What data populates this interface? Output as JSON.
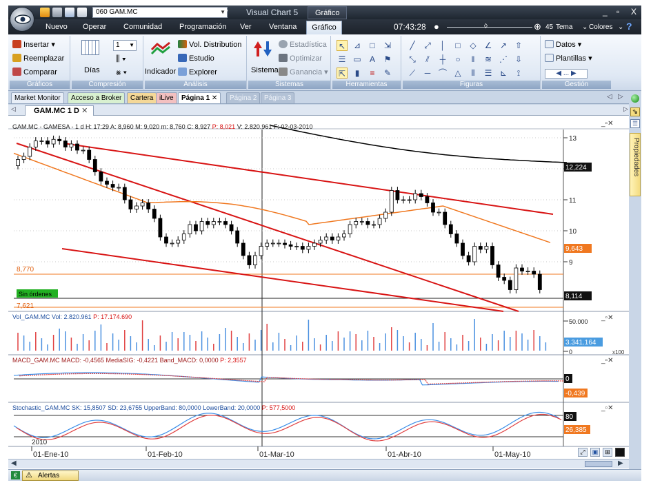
{
  "titlebar": {
    "symbol_value": "060 GAM.MC",
    "app_title": "Visual Chart 5",
    "context_tab": "Gráfico",
    "min_label": "_",
    "max_label": "▫",
    "close_label": "X"
  },
  "menubar": {
    "items": [
      "Nuevo",
      "Operar",
      "Comunidad",
      "Programación",
      "Ver",
      "Ventana",
      "Gráfico"
    ],
    "clock": "07:43:28",
    "zoom": "45",
    "tema": "Tema",
    "colores": "Colores"
  },
  "ribbon": {
    "graficos": {
      "label": "Gráficos",
      "insertar": "Insertar",
      "reemplazar": "Reemplazar",
      "comparar": "Comparar"
    },
    "compresion": {
      "label": "Compresión",
      "dias": "Días",
      "value": "1"
    },
    "analisis": {
      "label": "Análisis",
      "indicador": "Indicador",
      "vol": "Vol. Distribution",
      "estudio": "Estudio",
      "explorer": "Explorer"
    },
    "sistemas": {
      "label": "Sistemas",
      "sistema": "Sistema",
      "estadistica": "Estadística",
      "optimizar": "Optimizar",
      "ganancia": "Ganancia"
    },
    "herramientas": {
      "label": "Herramientas"
    },
    "figuras": {
      "label": "Figuras"
    },
    "gestion": {
      "label": "Gestión",
      "datos": "Datos",
      "plantillas": "Plantillas",
      "nav": "..."
    }
  },
  "pagetabs": [
    "Market Monitor",
    "Acceso a Broker",
    "Cartera",
    "iLive",
    "Página 1",
    "Página 2",
    "Página 3"
  ],
  "doc_tab": "GAM.MC 1 D",
  "side_tab": "Propiedades",
  "price_panel": {
    "header": "GAM.MC - GAMESA - 1 d H: 17:29 A: 8,960 M: 9,020 m: 8,760 C: 8,927",
    "header_p": "P: 8,021",
    "header_tail": "V: 2.820.961 F: 02-03-2010",
    "ticks": [
      "13",
      "12",
      "11",
      "10",
      "9"
    ],
    "line_labels": [
      "8,770",
      "7,621"
    ],
    "sin_ordenes": "Sin órdenes",
    "last_marks": [
      "12,224",
      "9,643",
      "8,114"
    ],
    "colors": {
      "black": "#000000",
      "orange": "#f07820",
      "red": "#d81414"
    }
  },
  "volume_panel": {
    "header": "Vol_GAM.MC Vol: 2.820.961",
    "header_p": "P: 17.174.690",
    "ticks": [
      "50.000",
      "0"
    ],
    "last": "3.341.164",
    "x100": "x100"
  },
  "macd_panel": {
    "header": "MACD_GAM.MC MACD: -0,4565 MediaSIG: -0,4221 Band_MACD: 0,0000",
    "header_p": "P: 2,3557",
    "marks": [
      "0",
      "-0,439"
    ]
  },
  "stoch_panel": {
    "header": "Stochastic_GAM.MC SK: 15,8507 SD: 23,6755 UpperBand: 80,0000 LowerBand: 20,0000",
    "header_p": "P: 577,5000",
    "marks": [
      "80",
      "26,385"
    ]
  },
  "xaxis": {
    "year": "2010",
    "labels": [
      "01-Ene-10",
      "01-Feb-10",
      "01-Mar-10",
      "01-Abr-10",
      "01-May-10"
    ]
  },
  "status": {
    "alertas": "Alertas"
  }
}
